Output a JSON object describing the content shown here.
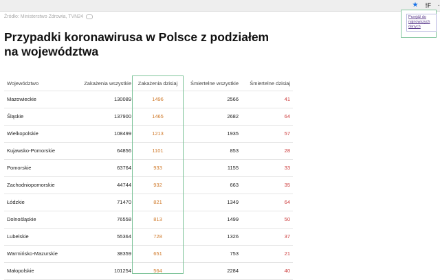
{
  "source_text": "Źródło: Ministerstwo Zdrowia, TVN24",
  "title": "Przypadki koronawirusa w Polsce z podziałem na województwa",
  "popup": {
    "link": "Przejdź do najnowszych danych"
  },
  "table": {
    "headers": [
      "Województwo",
      "Zakażenia wszystkie",
      "Zakażenia dzisiaj",
      "Śmiertelne wszystkie",
      "Śmiertelne dzisiaj"
    ],
    "rows": [
      [
        "Mazowieckie",
        "130089",
        "1496",
        "2566",
        "41"
      ],
      [
        "Śląskie",
        "137900",
        "1465",
        "2682",
        "64"
      ],
      [
        "Wielkopolskie",
        "108499",
        "1213",
        "1935",
        "57"
      ],
      [
        "Kujawsko-Pomorskie",
        "64856",
        "1101",
        "853",
        "28"
      ],
      [
        "Pomorskie",
        "63764",
        "933",
        "1155",
        "33"
      ],
      [
        "Zachodniopomorskie",
        "44744",
        "932",
        "663",
        "35"
      ],
      [
        "Łódzkie",
        "71470",
        "821",
        "1349",
        "64"
      ],
      [
        "Dolnośląskie",
        "76558",
        "813",
        "1499",
        "50"
      ],
      [
        "Lubelskie",
        "55364",
        "728",
        "1326",
        "37"
      ],
      [
        "Warmińsko-Mazurskie",
        "38359",
        "651",
        "753",
        "21"
      ],
      [
        "Małopolskie",
        "101254",
        "564",
        "2284",
        "40"
      ]
    ]
  },
  "colors": {
    "today": "#d07a2b",
    "deaths_today": "#cc3a3a",
    "highlight": "#7ec49a"
  },
  "icons": {
    "bookmark": "star-icon",
    "extension": "extension-icon",
    "comment": "comment-icon"
  }
}
